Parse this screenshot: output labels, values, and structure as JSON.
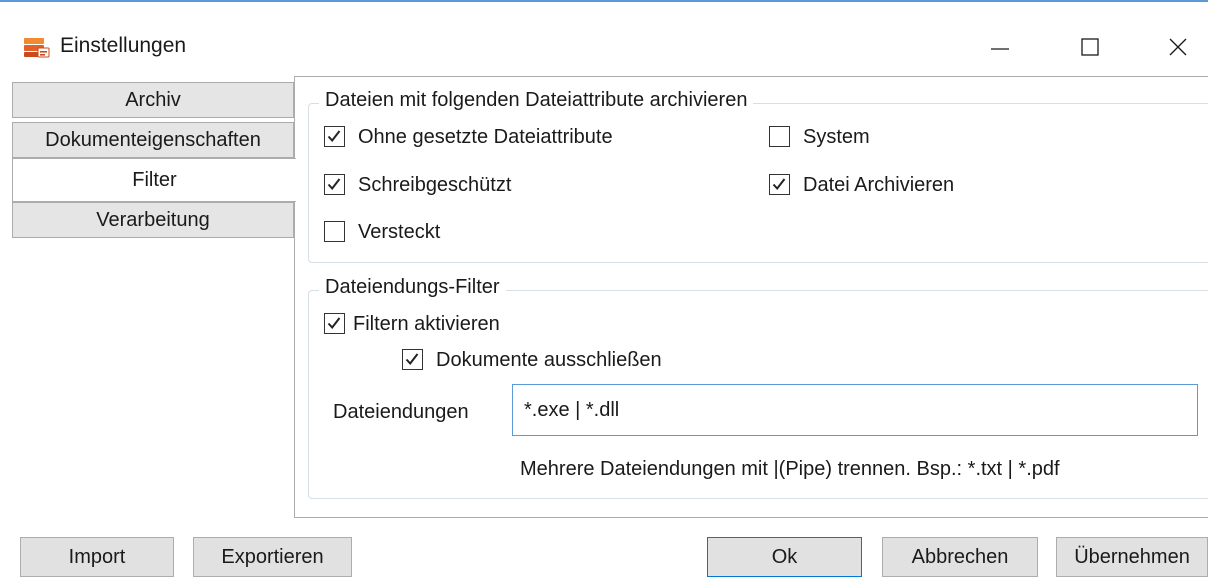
{
  "window": {
    "title": "Einstellungen",
    "app_icon": "archive-stack-icon",
    "controls": [
      "minimize-icon",
      "maximize-icon",
      "close-icon"
    ]
  },
  "tabs": [
    {
      "label": "Archiv",
      "active": false
    },
    {
      "label": "Dokumenteigenschaften",
      "active": false
    },
    {
      "label": "Filter",
      "active": true
    },
    {
      "label": "Verarbeitung",
      "active": false
    }
  ],
  "attributes_group": {
    "legend": "Dateien mit folgenden Dateiattribute archivieren",
    "options": {
      "ohne": {
        "label": "Ohne gesetzte Dateiattribute",
        "checked": true
      },
      "schreibgeschuetzt": {
        "label": "Schreibgeschützt",
        "checked": true
      },
      "versteckt": {
        "label": "Versteckt",
        "checked": false
      },
      "system": {
        "label": "System",
        "checked": false
      },
      "archivieren": {
        "label": "Datei Archivieren",
        "checked": true
      }
    }
  },
  "extension_group": {
    "legend": "Dateiendungs-Filter",
    "filter_enable": {
      "label": "Filtern aktivieren",
      "checked": true
    },
    "exclude_docs": {
      "label": "Dokumente ausschließen",
      "checked": true
    },
    "extensions_label": "Dateiendungen",
    "extensions_value": "*.exe | *.dll",
    "hint": "Mehrere Dateiendungen mit |(Pipe) trennen. Bsp.: *.txt | *.pdf"
  },
  "buttons": {
    "import": "Import",
    "export": "Exportieren",
    "ok": "Ok",
    "cancel": "Abbrechen",
    "apply": "Übernehmen"
  },
  "colors": {
    "accent": "#5b9bd5",
    "default_button_border": "#0078d7",
    "tab_bg": "#e5e5e5"
  }
}
